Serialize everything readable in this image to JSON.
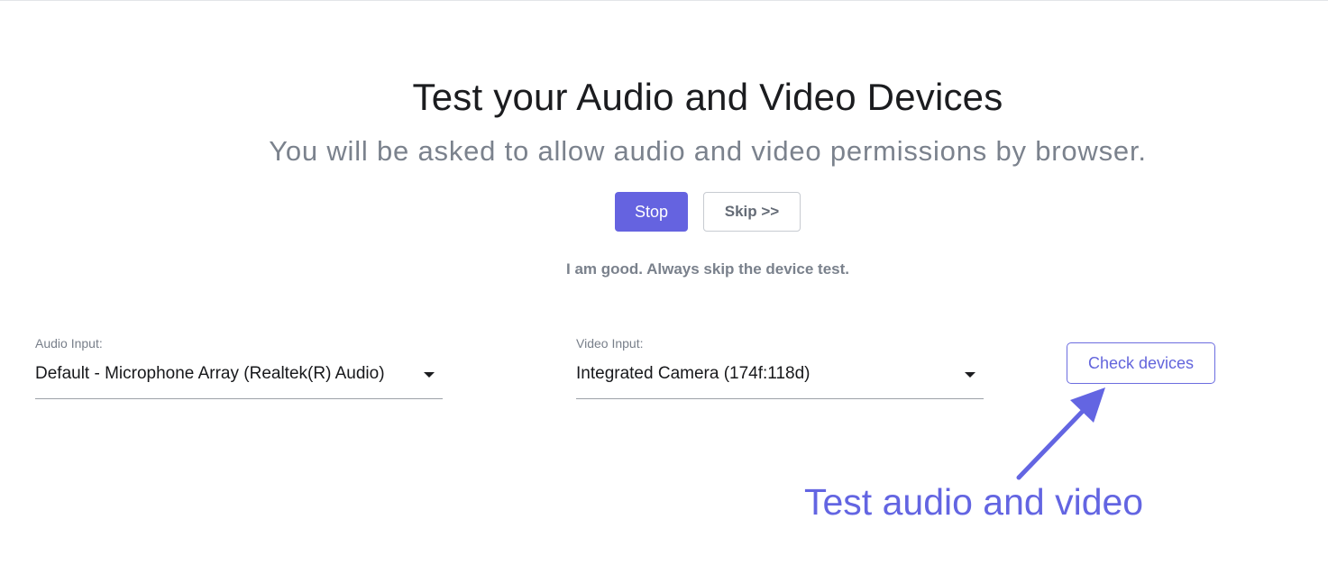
{
  "header": {
    "title": "Test your Audio and Video Devices",
    "subtitle": "You will be asked to allow audio and video permissions by browser."
  },
  "actions": {
    "stop_label": "Stop",
    "skip_label": "Skip >>",
    "always_skip_label": "I am good. Always skip the device test."
  },
  "audio_input": {
    "label": "Audio Input:",
    "value": "Default - Microphone Array (Realtek(R) Audio)"
  },
  "video_input": {
    "label": "Video Input:",
    "value": "Integrated Camera (174f:118d)"
  },
  "check_devices": {
    "label": "Check devices"
  },
  "annotation": {
    "text": "Test audio and video",
    "icon": "arrow-icon",
    "color": "#6365e2"
  },
  "colors": {
    "accent": "#6563e0",
    "title": "#1b1c1f",
    "muted": "#7b828d"
  }
}
